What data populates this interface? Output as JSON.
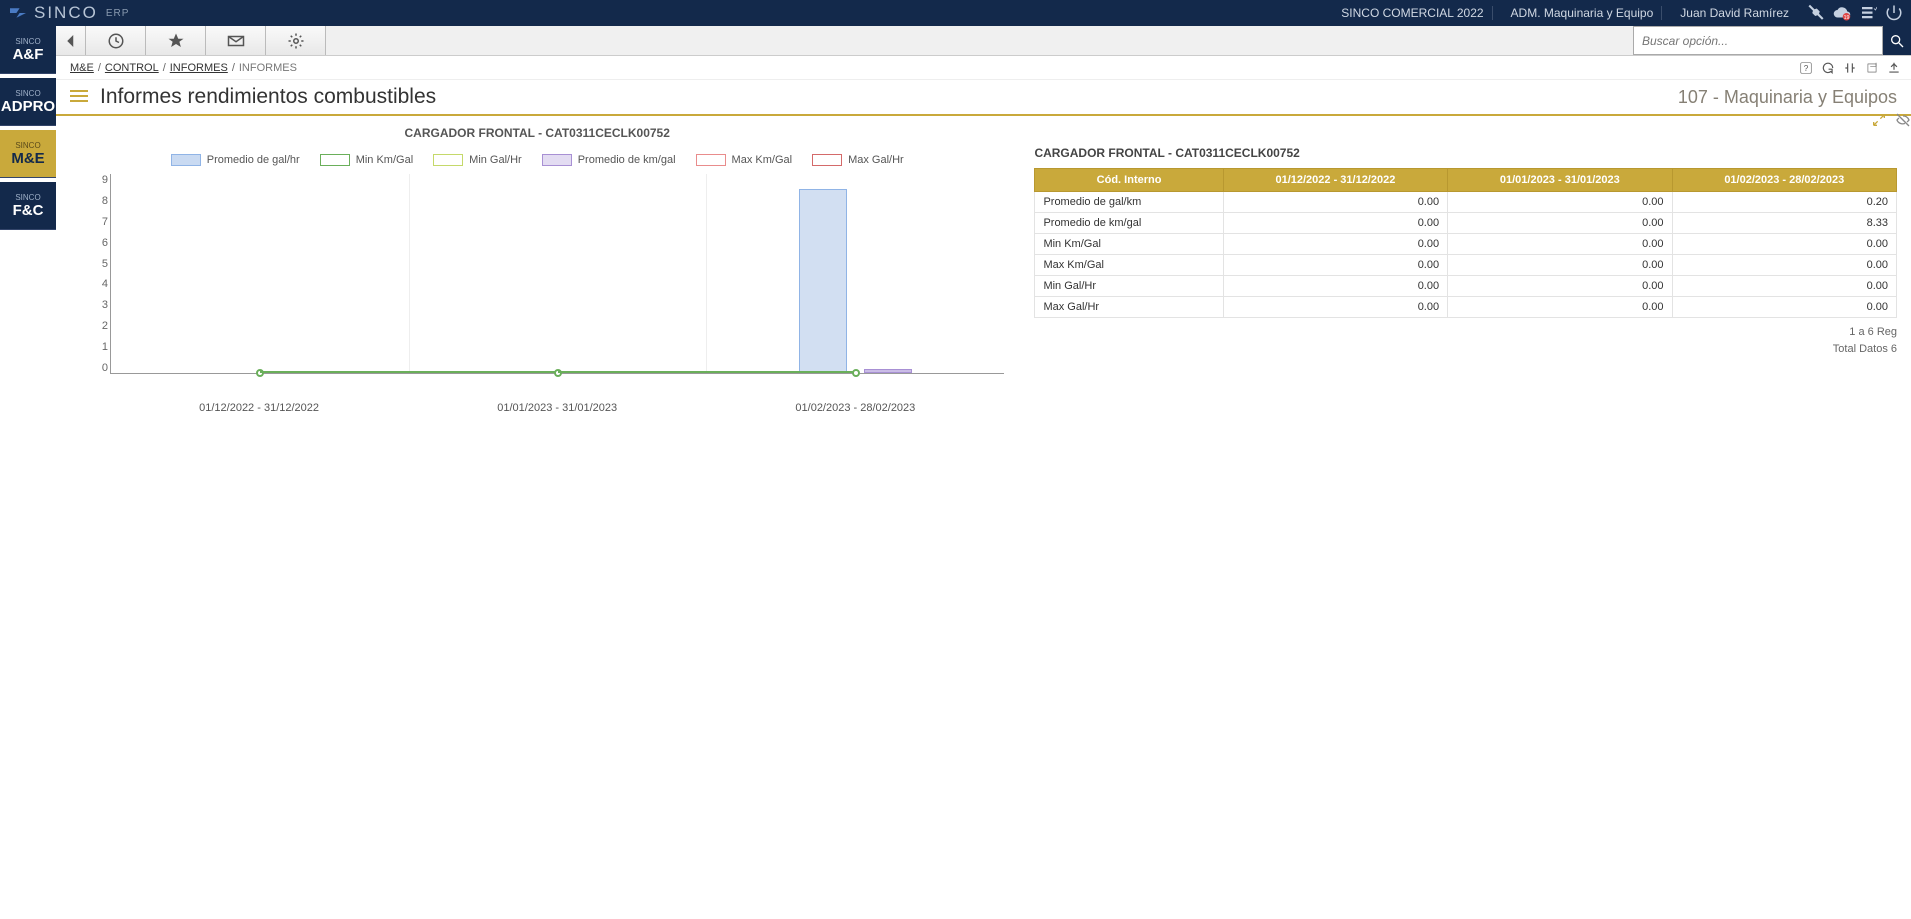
{
  "brand": {
    "name": "SINCO",
    "suffix": "ERP"
  },
  "header": {
    "company": "SINCO COMERCIAL 2022",
    "area": "ADM. Maquinaria y Equipo",
    "user": "Juan David Ramírez"
  },
  "search": {
    "placeholder": "Buscar opción..."
  },
  "breadcrumb": {
    "items": [
      "M&E",
      "CONTROL",
      "INFORMES"
    ],
    "current": "INFORMES"
  },
  "page": {
    "title": "Informes rendimientos combustibles",
    "context": "107 - Maquinaria y Equipos"
  },
  "modules": [
    {
      "small": "SINCO",
      "big": "A&F"
    },
    {
      "small": "SINCO",
      "big": "ADPRO"
    },
    {
      "small": "SINCO",
      "big": "M&E"
    },
    {
      "small": "SINCO",
      "big": "F&C"
    }
  ],
  "chart": {
    "title": "CARGADOR FRONTAL - CAT0311CECLK00752",
    "legend": [
      {
        "label": "Promedio de gal/hr",
        "fill": "#c9daf2",
        "stroke": "#90b4e6"
      },
      {
        "label": "Min Km/Gal",
        "fill": "#fff",
        "stroke": "#6aaf5a"
      },
      {
        "label": "Min Gal/Hr",
        "fill": "#fff",
        "stroke": "#c5d96a"
      },
      {
        "label": "Promedio de km/gal",
        "fill": "#e3dcf2",
        "stroke": "#a890d4"
      },
      {
        "label": "Max Km/Gal",
        "fill": "#fff",
        "stroke": "#e98c8c"
      },
      {
        "label": "Max Gal/Hr",
        "fill": "#fff",
        "stroke": "#d46a6a"
      }
    ],
    "y_ticks": [
      "9",
      "8",
      "7",
      "6",
      "5",
      "4",
      "3",
      "2",
      "1",
      "0"
    ],
    "x_labels": [
      "01/12/2022 - 31/12/2022",
      "01/01/2023 - 31/01/2023",
      "01/02/2023 - 28/02/2023"
    ]
  },
  "chart_data": {
    "type": "bar",
    "title": "CARGADOR FRONTAL - CAT0311CECLK00752",
    "categories": [
      "01/12/2022 - 31/12/2022",
      "01/01/2023 - 31/01/2023",
      "01/02/2023 - 28/02/2023"
    ],
    "ylim": [
      0,
      9
    ],
    "series": [
      {
        "name": "Promedio de gal/hr",
        "values": [
          0,
          0,
          8.33
        ]
      },
      {
        "name": "Min Km/Gal",
        "values": [
          0,
          0,
          0
        ]
      },
      {
        "name": "Min Gal/Hr",
        "values": [
          0,
          0,
          0
        ]
      },
      {
        "name": "Promedio de km/gal",
        "values": [
          0,
          0,
          0.2
        ]
      },
      {
        "name": "Max Km/Gal",
        "values": [
          0,
          0,
          0
        ]
      },
      {
        "name": "Max Gal/Hr",
        "values": [
          0,
          0,
          0
        ]
      }
    ]
  },
  "table": {
    "title": "CARGADOR FRONTAL - CAT0311CECLK00752",
    "headers": [
      "Cód. Interno",
      "01/12/2022 - 31/12/2022",
      "01/01/2023 - 31/01/2023",
      "01/02/2023 - 28/02/2023"
    ],
    "rows": [
      {
        "label": "Promedio de gal/km",
        "v": [
          "0.00",
          "0.00",
          "0.20"
        ]
      },
      {
        "label": "Promedio de km/gal",
        "v": [
          "0.00",
          "0.00",
          "8.33"
        ]
      },
      {
        "label": "Min Km/Gal",
        "v": [
          "0.00",
          "0.00",
          "0.00"
        ]
      },
      {
        "label": "Max Km/Gal",
        "v": [
          "0.00",
          "0.00",
          "0.00"
        ]
      },
      {
        "label": "Min Gal/Hr",
        "v": [
          "0.00",
          "0.00",
          "0.00"
        ]
      },
      {
        "label": "Max Gal/Hr",
        "v": [
          "0.00",
          "0.00",
          "0.00"
        ]
      }
    ],
    "footer1": "1 a 6 Reg",
    "footer2": "Total Datos 6"
  }
}
